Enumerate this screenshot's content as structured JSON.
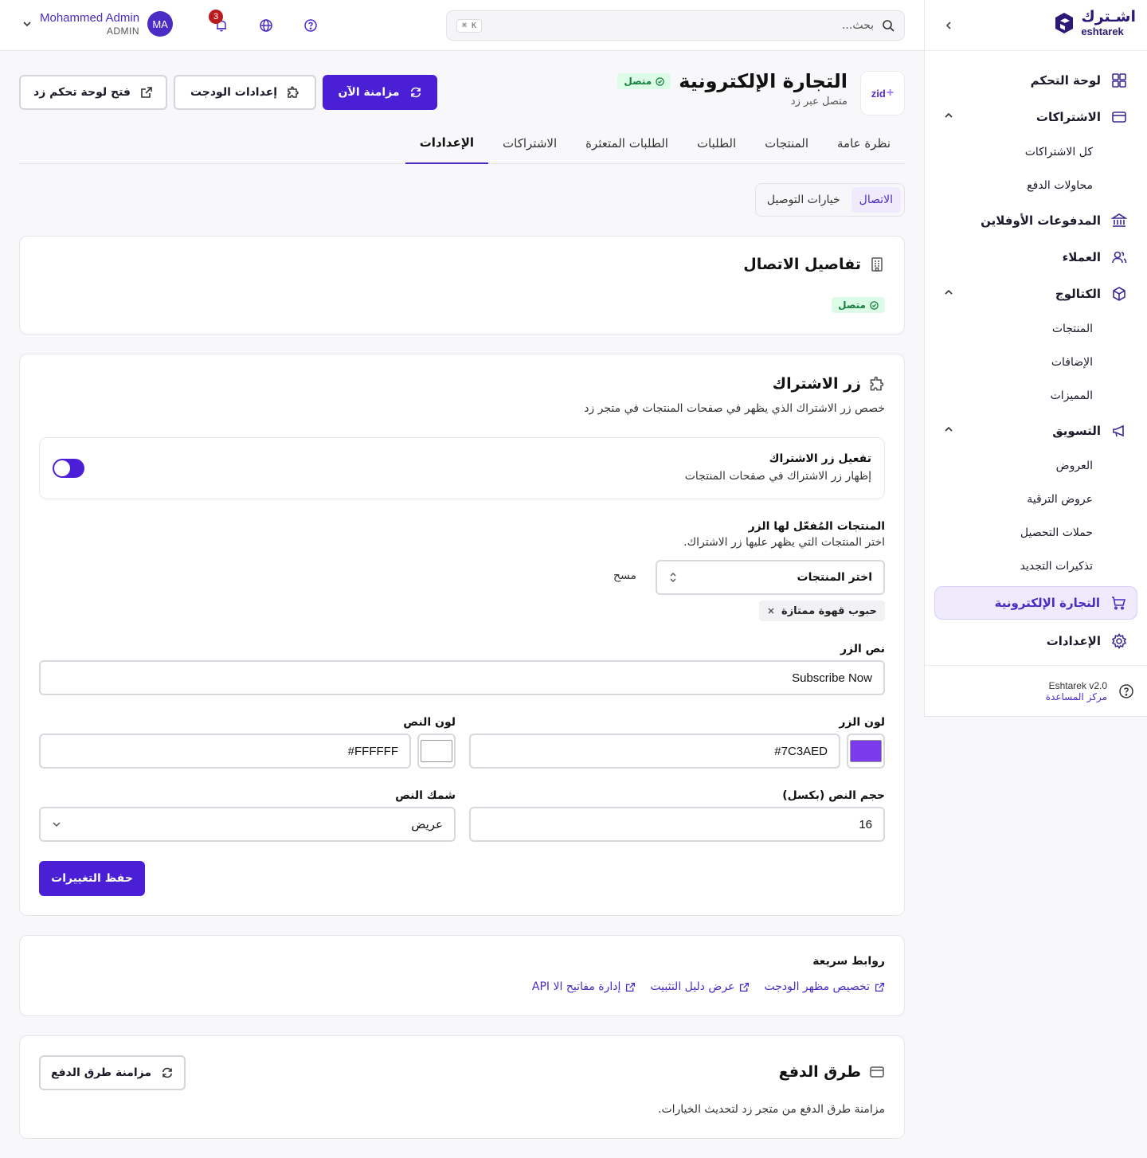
{
  "brand": {
    "name_ar": "اشـترك",
    "name_en": "eshtarek"
  },
  "sidebar": {
    "items": [
      {
        "label": "لوحة التحكم"
      },
      {
        "label": "الاشتراكات",
        "children": [
          "كل الاشتراكات",
          "محاولات الدفع"
        ]
      },
      {
        "label": "المدفوعات الأوفلاين"
      },
      {
        "label": "العملاء"
      },
      {
        "label": "الكتالوج",
        "children": [
          "المنتجات",
          "الإضافات",
          "المميزات"
        ]
      },
      {
        "label": "التسويق",
        "children": [
          "العروض",
          "عروض الترقية",
          "حملات التحصيل",
          "تذكيرات التجديد"
        ]
      },
      {
        "label": "التجارة الإلكترونية",
        "active": true
      },
      {
        "label": "الإعدادات"
      }
    ],
    "footer": {
      "version": "Eshtarek v2.0",
      "help": "مركز المساعدة"
    }
  },
  "topbar": {
    "search_placeholder": "بحث...",
    "shortcut": "⌘ K",
    "notifications_count": "3",
    "user": {
      "name": "Mohammed Admin",
      "role": "ADMIN",
      "initials": "MA"
    }
  },
  "page": {
    "title": "التجارة الإلكترونية",
    "status": "متصل",
    "subtitle": "متصل عبر زد",
    "logo_text": "zid",
    "actions": {
      "sync": "مزامنة الآن",
      "widget_settings": "إعدادات الودجت",
      "open_dashboard": "فتح لوحة تحكم زد"
    }
  },
  "tabs": [
    "نظرة عامة",
    "المنتجات",
    "الطلبات",
    "الطلبات المتعثرة",
    "الاشتراكات",
    "الإعدادات"
  ],
  "active_tab": "الإعدادات",
  "subtabs": [
    "الاتصال",
    "خيارات التوصيل"
  ],
  "connection_card": {
    "title": "تفاصيل الاتصال",
    "status": "متصل"
  },
  "subscribe_card": {
    "title": "زر الاشتراك",
    "description": "خصص زر الاشتراك الذي يظهر في صفحات المنتجات في متجر زد",
    "toggle": {
      "title": "تفعيل زر الاشتراك",
      "help": "إظهار زر الاشتراك في صفحات المنتجات",
      "on": true
    },
    "products": {
      "label": "المنتجات المُفعّل لها الزر",
      "help": "اختر المنتجات التي يظهر عليها زر الاشتراك.",
      "select_placeholder": "اختر المنتجات",
      "clear": "مسح",
      "selected": [
        "حبوب قهوة ممتازة"
      ]
    },
    "button_text": {
      "label": "نص الزر",
      "value": "Subscribe Now"
    },
    "button_color": {
      "label": "لون الزر",
      "value": "#7C3AED"
    },
    "text_color": {
      "label": "لون النص",
      "value": "#FFFFFF"
    },
    "font_size": {
      "label": "حجم النص (بكسل)",
      "value": "16"
    },
    "font_weight": {
      "label": "شمك النص",
      "value": "عريض"
    },
    "save": "حفظ التغييرات"
  },
  "quick_links": {
    "title": "روابط سريعة",
    "links": [
      "تخصيص مظهر الودجت",
      "عرض دليل التثبيت",
      "إدارة مفاتيح الا API"
    ]
  },
  "payment_card": {
    "title": "طرق الدفع",
    "sync_button": "مزامنة طرق الدفع",
    "description": "مزامنة طرق الدفع من متجر زد لتحديث الخيارات."
  },
  "colors": {
    "primary": "#4b1fd6",
    "accent_text": "#4b2cc4",
    "success": "#15803d"
  }
}
